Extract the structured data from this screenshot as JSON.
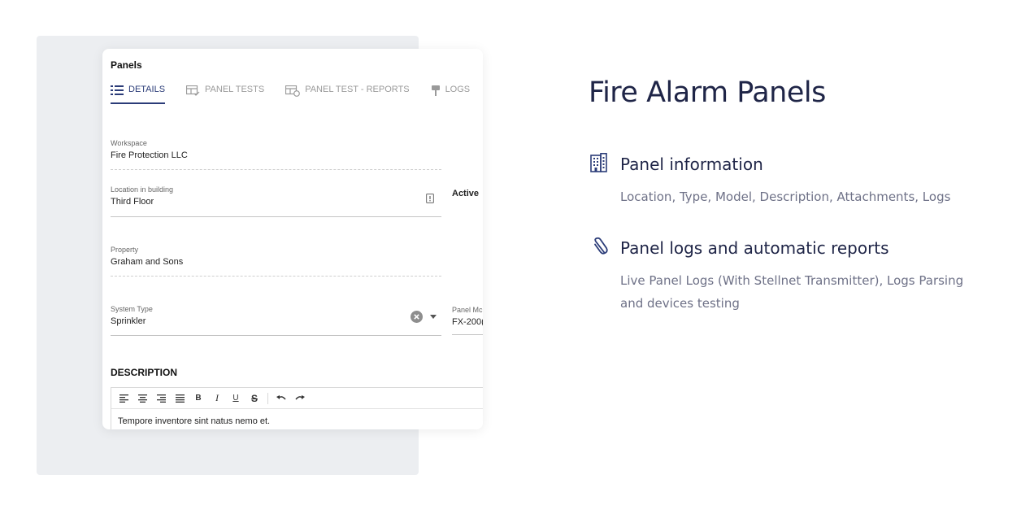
{
  "card": {
    "title": "Panels",
    "tabs": [
      {
        "label": "DETAILS",
        "active": true,
        "icon": "list-icon"
      },
      {
        "label": "PANEL TESTS",
        "active": false,
        "icon": "table-check-icon"
      },
      {
        "label": "PANEL TEST - REPORTS",
        "active": false,
        "icon": "table-report-icon"
      },
      {
        "label": "LOGS",
        "active": false,
        "icon": "pin-icon"
      }
    ],
    "fields": {
      "workspace": {
        "label": "Workspace",
        "value": "Fire Protection LLC"
      },
      "location": {
        "label": "Location in building",
        "value": "Third  Floor"
      },
      "property": {
        "label": "Property",
        "value": "Graham and Sons"
      },
      "system_type": {
        "label": "System Type",
        "value": "Sprinkler"
      },
      "panel_model": {
        "label": "Panel Mc",
        "value": "FX-200("
      }
    },
    "active_label": "Active",
    "description": {
      "heading": "DESCRIPTION",
      "text": "Tempore inventore sint natus nemo et."
    }
  },
  "headline": "Fire Alarm Panels",
  "features": [
    {
      "icon": "building-icon",
      "title": "Panel information",
      "description": "Location, Type, Model, Description, Attachments, Logs"
    },
    {
      "icon": "paperclip-icon",
      "title": "Panel logs and automatic reports",
      "description": "Live Panel Logs (With Stellnet Transmitter), Logs Parsing and devices testing"
    }
  ],
  "colors": {
    "accent": "#2b3c78",
    "title": "#1f2547",
    "muted": "#6e7187",
    "backdrop": "#eceef1"
  }
}
